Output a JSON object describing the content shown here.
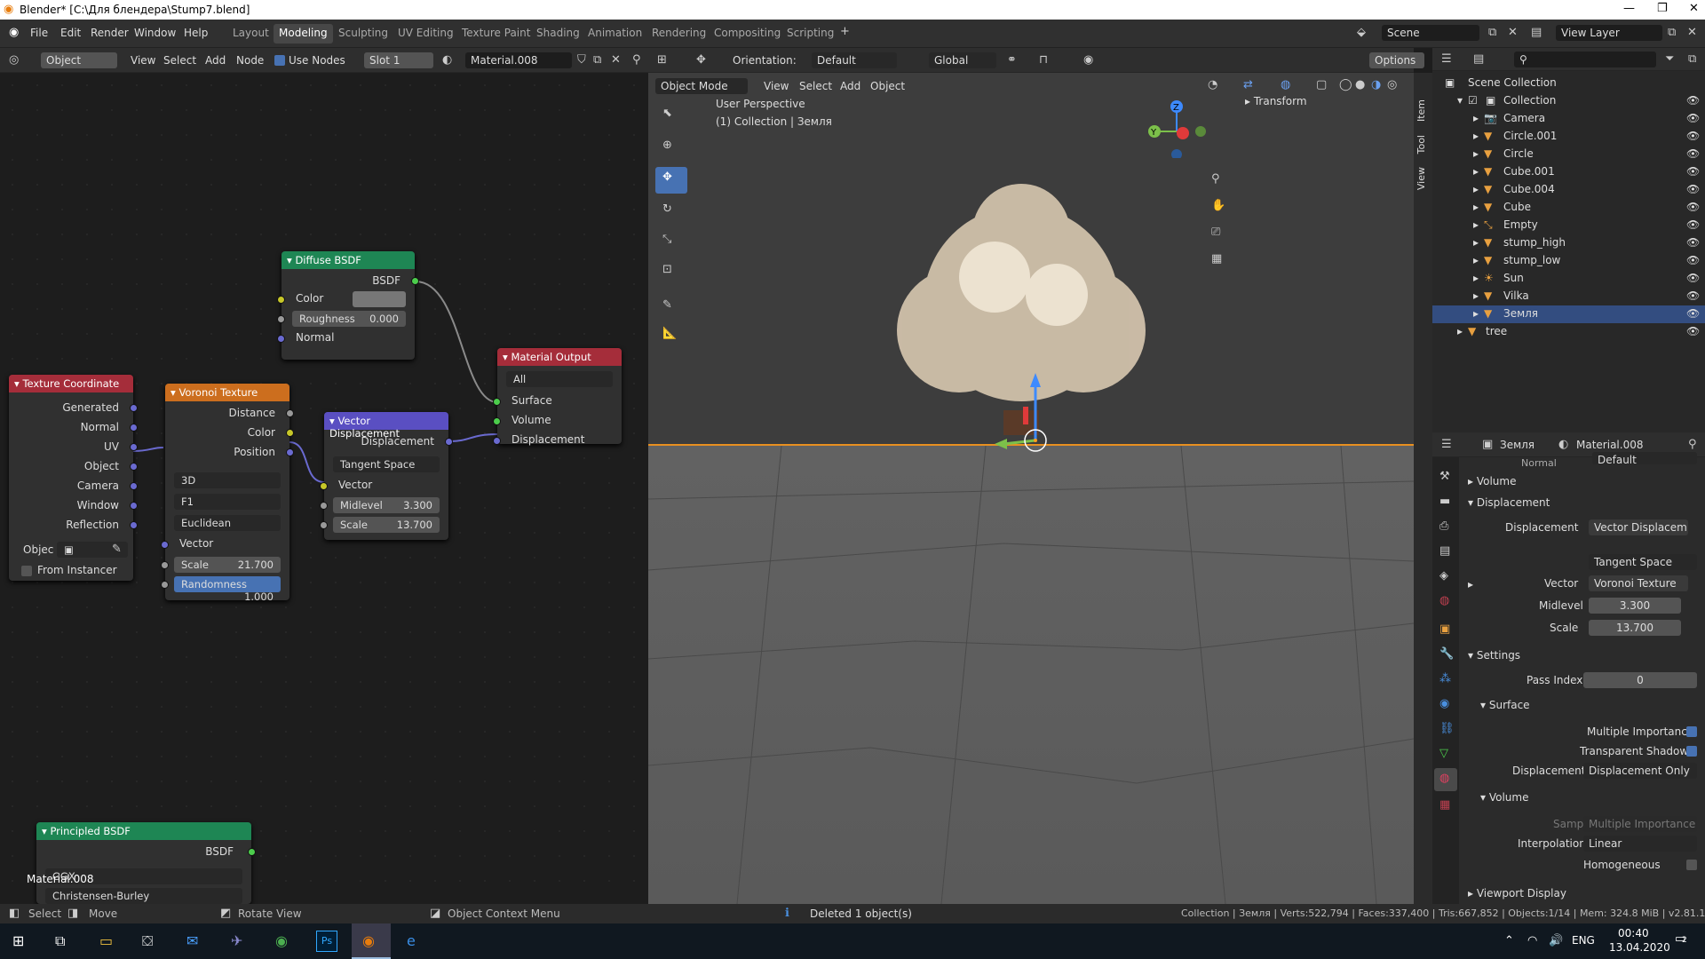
{
  "title": "Blender* [C:\\Для блендера\\Stump7.blend]",
  "menu": [
    "File",
    "Edit",
    "Render",
    "Window",
    "Help"
  ],
  "workspaces": [
    "Layout",
    "Modeling",
    "Sculpting",
    "UV Editing",
    "Texture Paint",
    "Shading",
    "Animation",
    "Rendering",
    "Compositing",
    "Scripting"
  ],
  "active_workspace": "Modeling",
  "scene": "Scene",
  "view_layer": "View Layer",
  "node_header": {
    "mode": "Object",
    "view": "View",
    "select": "Select",
    "add": "Add",
    "node": "Node",
    "use_nodes": "Use Nodes",
    "slot": "Slot 1",
    "material": "Material.008"
  },
  "nodes": {
    "diffuse": {
      "title": "Diffuse BSDF",
      "out": "BSDF",
      "color": "Color",
      "roughness": "Roughness",
      "roughness_val": "0.000",
      "normal": "Normal"
    },
    "texcoord": {
      "title": "Texture Coordinate",
      "outputs": [
        "Generated",
        "Normal",
        "UV",
        "Object",
        "Camera",
        "Window",
        "Reflection"
      ],
      "object": "Objec",
      "from_instancer": "From Instancer"
    },
    "voronoi": {
      "title": "Voronoi Texture",
      "outputs": [
        "Distance",
        "Color",
        "Position"
      ],
      "dim": "3D",
      "feature": "F1",
      "metric": "Euclidean",
      "vector": "Vector",
      "scale": "Scale",
      "scale_val": "21.700",
      "randomness": "Randomness",
      "randomness_val": "1.000"
    },
    "vecdisp": {
      "title": "Vector Displacement",
      "out": "Displacement",
      "space": "Tangent Space",
      "vector": "Vector",
      "midlevel": "Midlevel",
      "midlevel_val": "3.300",
      "scale": "Scale",
      "scale_val": "13.700"
    },
    "matout": {
      "title": "Material Output",
      "target": "All",
      "inputs": [
        "Surface",
        "Volume",
        "Displacement"
      ]
    },
    "principled": {
      "title": "Principled BSDF",
      "out": "BSDF",
      "dist": "GGX",
      "sss": "Christensen-Burley"
    }
  },
  "node_footer": "Material.008",
  "viewport": {
    "mode": "Object Mode",
    "view": "View",
    "select": "Select",
    "add": "Add",
    "object": "Object",
    "orientation_label": "Orientation:",
    "orientation": "Default",
    "transform_space": "Global",
    "options": "Options",
    "info_line1": "User Perspective",
    "info_line2": "(1) Collection | Земля",
    "transform_panel": "Transform",
    "tabs": [
      "Item",
      "Tool",
      "View"
    ]
  },
  "outliner": {
    "root": "Scene Collection",
    "collection": "Collection",
    "items": [
      "Camera",
      "Circle.001",
      "Circle",
      "Cube.001",
      "Cube.004",
      "Cube",
      "Empty",
      "stump_high",
      "stump_low",
      "Sun",
      "Vilka",
      "Земля"
    ],
    "tree": "tree",
    "selected": "Земля"
  },
  "properties": {
    "object": "Земля",
    "material": "Material.008",
    "normal_label": "Normal",
    "normal_val": "Default",
    "volume": "Volume",
    "displacement": "Displacement",
    "disp_label": "Displacement",
    "disp_val": "Vector Displacem...",
    "space": "Tangent Space",
    "vector_label": "Vector",
    "vector_val": "Voronoi Texture",
    "midlevel_label": "Midlevel",
    "midlevel_val": "3.300",
    "scale_label": "Scale",
    "scale_val": "13.700",
    "settings": "Settings",
    "pass_index_label": "Pass Index",
    "pass_index": "0",
    "surface": "Surface",
    "multi_imp": "Multiple Importance",
    "transp_shadows": "Transparent Shadows",
    "disp_method_label": "Displacement",
    "disp_method": "Displacement Only",
    "volume_sub": "Volume",
    "sampling_label": "Sampling",
    "sampling_val": "Multiple Importance",
    "interp_label": "Interpolation",
    "interp_val": "Linear",
    "homogeneous": "Homogeneous",
    "viewport_display": "Viewport Display"
  },
  "status": {
    "select": "Select",
    "move": "Move",
    "rotate": "Rotate View",
    "context": "Object Context Menu",
    "message": "Deleted 1 object(s)",
    "stats": "Collection | Земля | Verts:522,794 | Faces:337,400 | Tris:667,852 | Objects:1/14 | Mem: 324.8 MiB | v2.81.16"
  },
  "taskbar": {
    "lang": "ENG",
    "time": "00:40",
    "date": "13.04.2020",
    "notif": "2"
  },
  "colors": {
    "selected": "#334d80",
    "accent": "#4772b3",
    "shader_green": "#1e8654",
    "texture_orange": "#cc6e1e",
    "input_red": "#a52d3a",
    "vector_purple": "#5a4fc2",
    "output_red": "#a52d3a"
  }
}
